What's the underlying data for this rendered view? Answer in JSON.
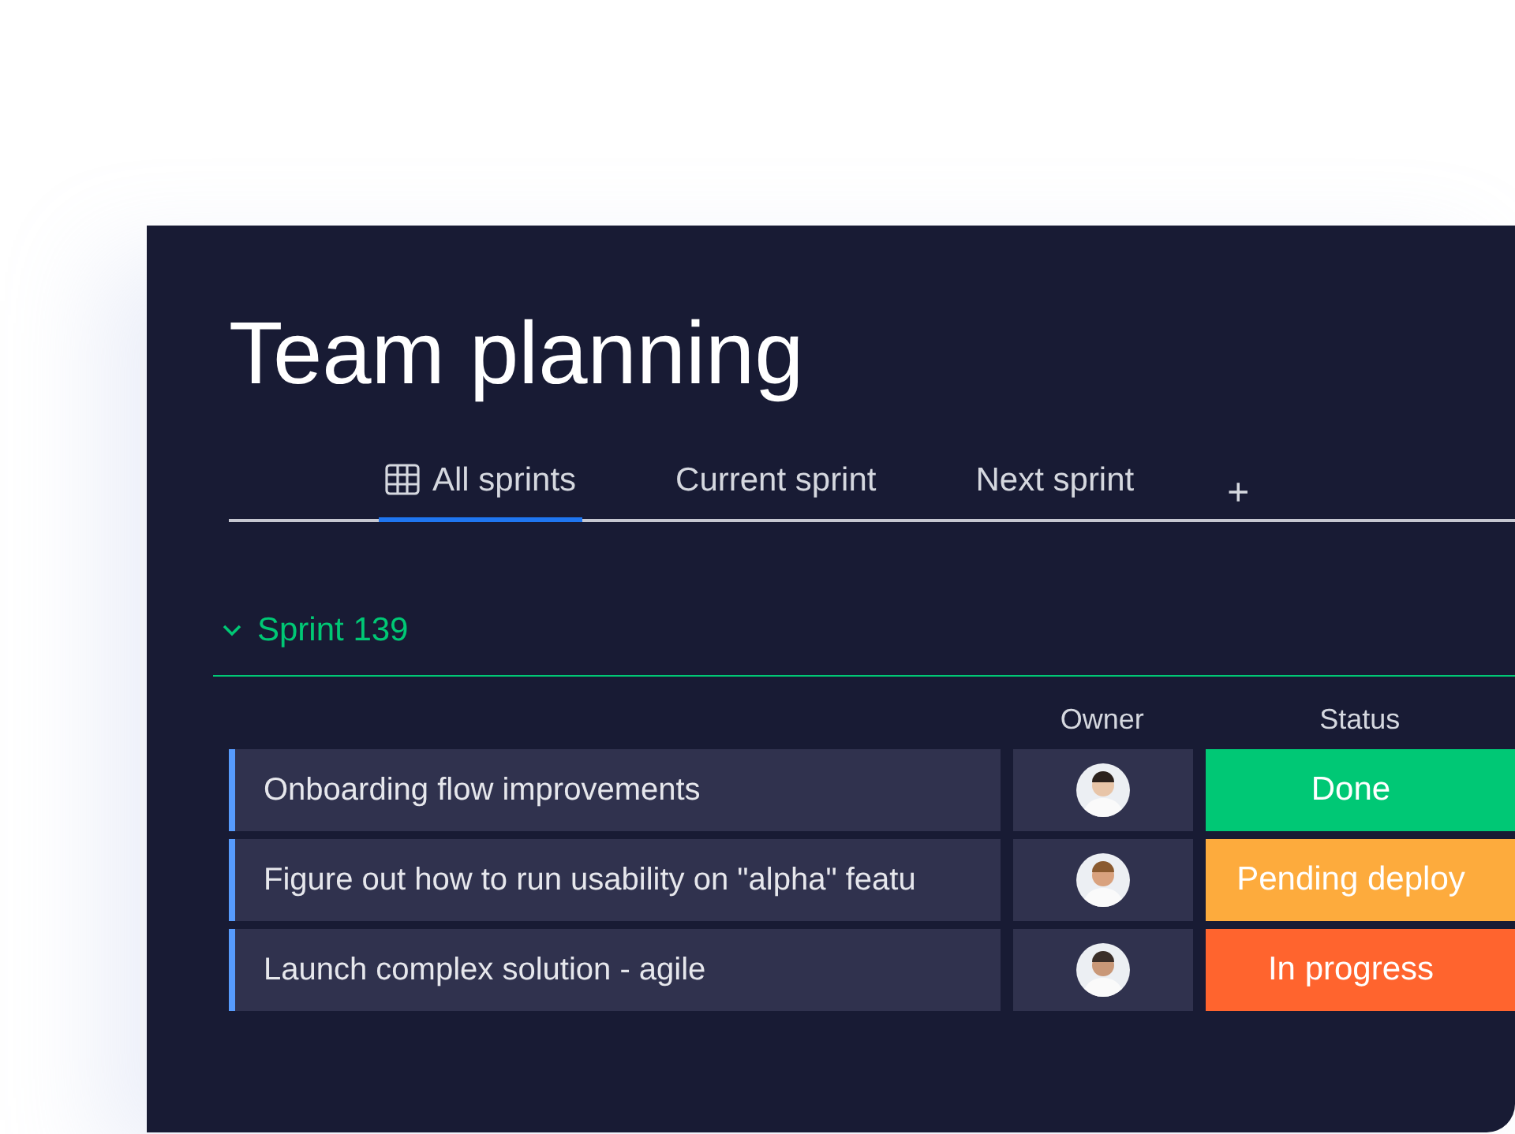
{
  "title": "Team planning",
  "tabs": [
    {
      "label": "All sprints",
      "selected": true,
      "kind": "table"
    },
    {
      "label": "Current sprint",
      "selected": false
    },
    {
      "label": "Next sprint",
      "selected": false
    }
  ],
  "add_tab": "+",
  "group": {
    "name": "Sprint 139",
    "expanded": true,
    "color": "#00c875",
    "columns": [
      "Owner",
      "Status"
    ],
    "rows": [
      {
        "task": "Onboarding flow improvements",
        "status": "Done",
        "color": "#00c875"
      },
      {
        "task": "Figure out how to run usability on \"alpha\" featu",
        "status": "Pending deploy",
        "color": "#fdab3d"
      },
      {
        "task": "Launch complex solution - agile",
        "status": "In progress",
        "color": "#ff642e"
      }
    ]
  }
}
